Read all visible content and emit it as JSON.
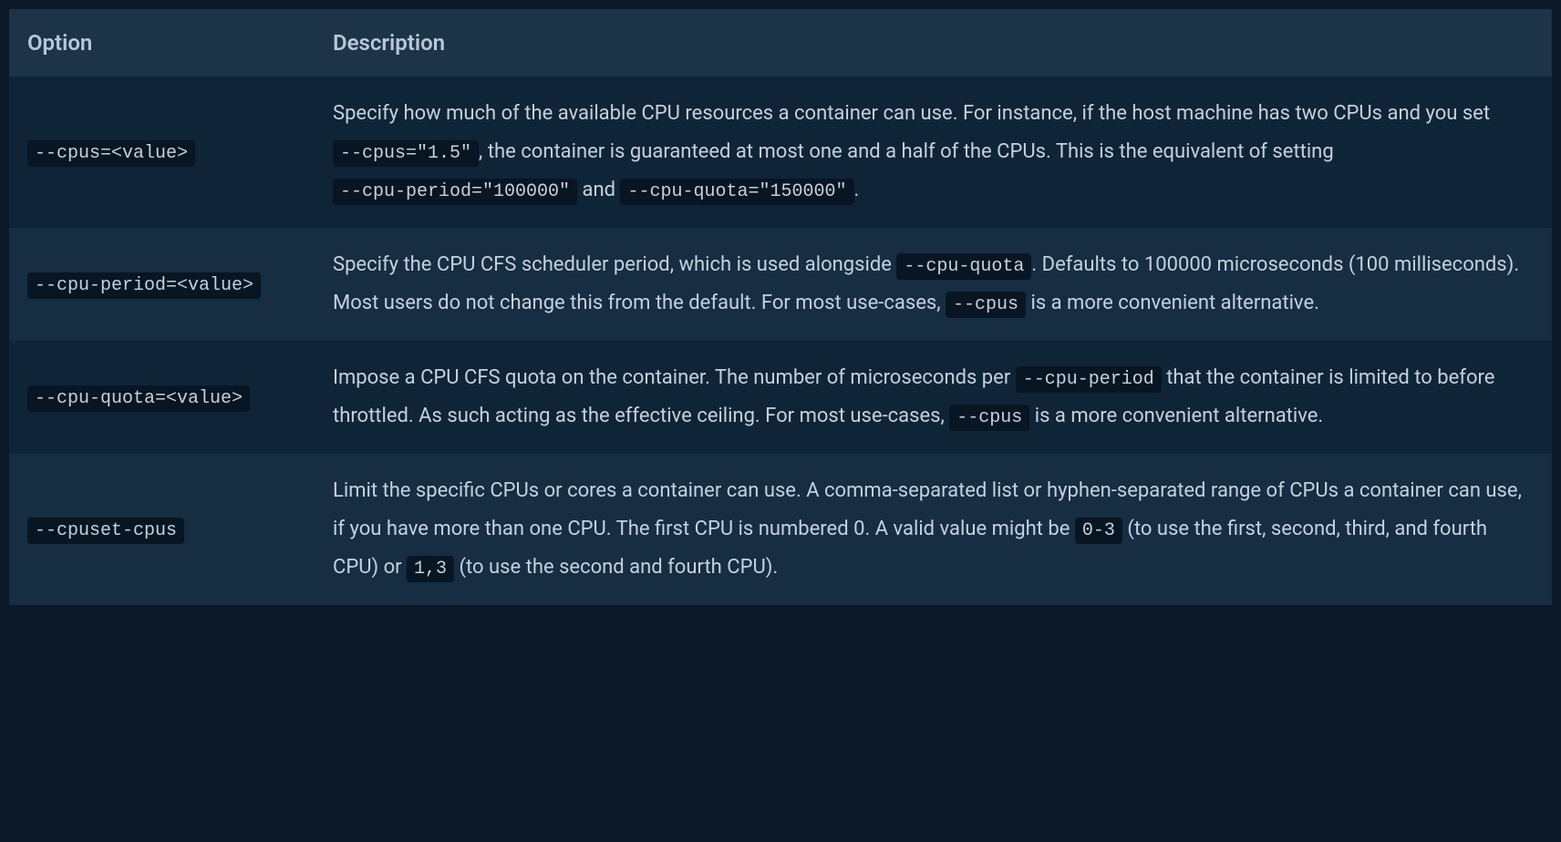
{
  "table": {
    "headers": {
      "option": "Option",
      "description": "Description"
    },
    "rows": [
      {
        "option": "--cpus=<value>",
        "desc": {
          "t1": "Specify how much of the available CPU resources a container can use. For instance, if the host machine has two CPUs and you set ",
          "c1": "--cpus=\"1.5\"",
          "t2": ", the container is guaranteed at most one and a half of the CPUs. This is the equivalent of setting ",
          "c2": "--cpu-period=\"100000\"",
          "t3": " and ",
          "c3": "--cpu-quota=\"150000\"",
          "t4": "."
        }
      },
      {
        "option": "--cpu-period=<value>",
        "desc": {
          "t1": "Specify the CPU CFS scheduler period, which is used alongside ",
          "c1": "--cpu-quota",
          "t2": ". Defaults to 100000 microseconds (100 milliseconds). Most users do not change this from the default. For most use-cases, ",
          "c2": "--cpus",
          "t3": " is a more convenient alternative."
        }
      },
      {
        "option": "--cpu-quota=<value>",
        "desc": {
          "t1": "Impose a CPU CFS quota on the container. The number of microseconds per ",
          "c1": "--cpu-period",
          "t2": " that the container is limited to before throttled. As such acting as the effective ceiling. For most use-cases, ",
          "c2": "--cpus",
          "t3": " is a more convenient alternative."
        }
      },
      {
        "option": "--cpuset-cpus",
        "desc": {
          "t1": "Limit the specific CPUs or cores a container can use. A comma-separated list or hyphen-separated range of CPUs a container can use, if you have more than one CPU. The first CPU is numbered 0. A valid value might be ",
          "c1": "0-3",
          "t2": " (to use the first, second, third, and fourth CPU) or ",
          "c2": "1,3",
          "t3": " (to use the second and fourth CPU)."
        }
      }
    ]
  }
}
